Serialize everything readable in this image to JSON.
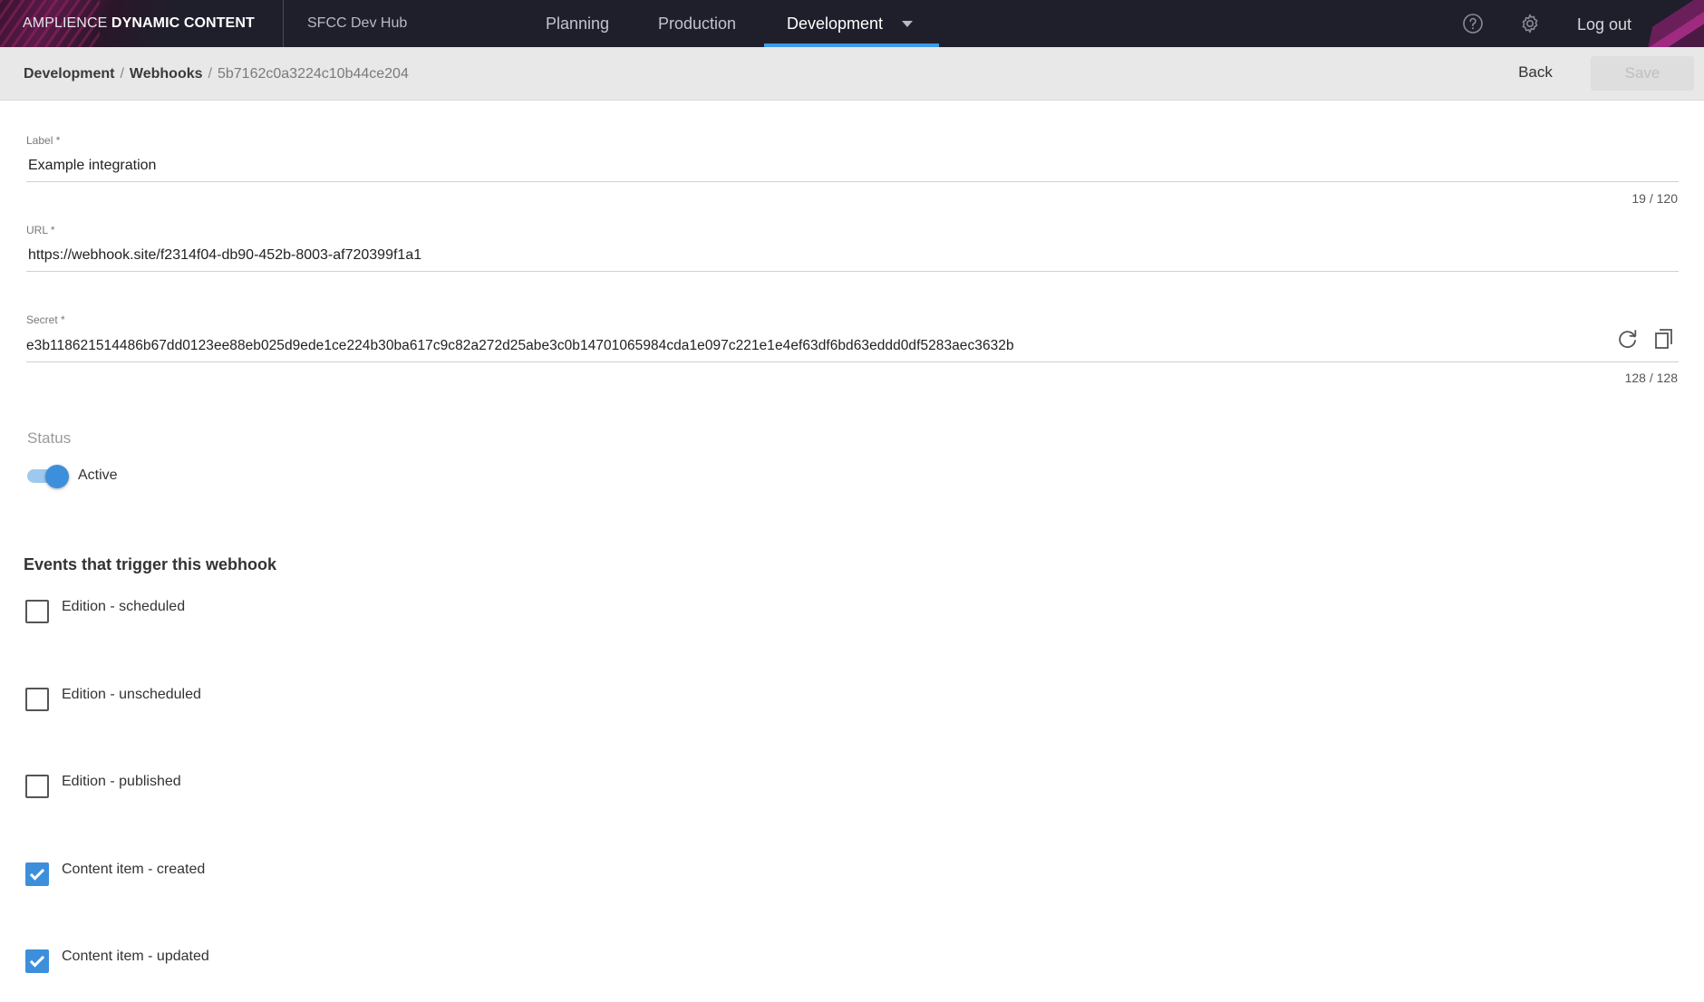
{
  "topbar": {
    "brand_prefix": "AMPLIENCE",
    "brand_name": "DYNAMIC CONTENT",
    "hub_name": "SFCC Dev Hub",
    "nav": [
      "Planning",
      "Production",
      "Development"
    ],
    "active_nav": "Development",
    "logout_label": "Log out",
    "icons": [
      "help-icon",
      "gear-icon",
      "chevron-down-icon"
    ],
    "accent_color": "#3d9ae8"
  },
  "breadcrumb": {
    "items": [
      "Development",
      "Webhooks"
    ],
    "current": "5b7162c0a3224c10b44ce204",
    "separator": "/"
  },
  "actions": {
    "back_label": "Back",
    "save_label": "Save",
    "save_disabled": true
  },
  "form": {
    "label": {
      "caption": "Label *",
      "value": "Example integration",
      "counter": "19 / 120"
    },
    "url": {
      "caption": "URL *",
      "value": "https://webhook.site/f2314f04-db90-452b-8003-af720399f1a1"
    },
    "secret": {
      "caption": "Secret *",
      "value": "e3b118621514486b67dd0123ee88eb025d9ede1ce224b30ba617c9c82a272d25abe3c0b14701065984cda1e097c221e1e4ef63df6bd63eddd0df5283aec3632b",
      "counter": "128 / 128",
      "icons": [
        "refresh-icon",
        "copy-icon"
      ]
    },
    "status": {
      "caption": "Status",
      "toggle_label": "Active",
      "active": true
    }
  },
  "events": {
    "title": "Events that trigger this webhook",
    "items": [
      {
        "label": "Edition - scheduled",
        "checked": false
      },
      {
        "label": "Edition - unscheduled",
        "checked": false
      },
      {
        "label": "Edition - published",
        "checked": false
      },
      {
        "label": "Content item - created",
        "checked": true
      },
      {
        "label": "Content item - updated",
        "checked": true
      }
    ]
  }
}
